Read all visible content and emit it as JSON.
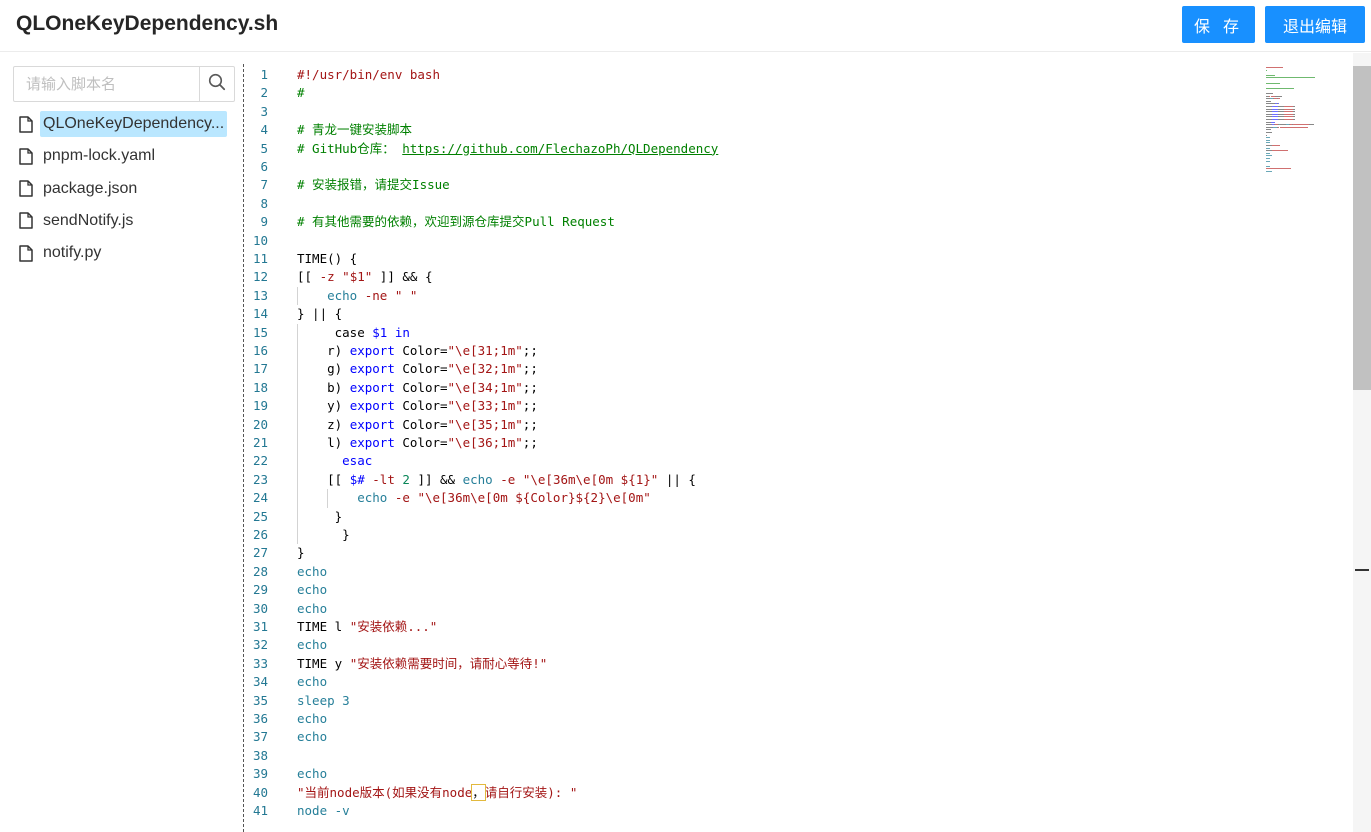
{
  "header": {
    "title": "QLOneKeyDependency.sh",
    "save_label": "保 存",
    "exit_label": "退出编辑",
    "accent_color": "#1890ff"
  },
  "sidebar": {
    "search": {
      "placeholder": "请输入脚本名",
      "value": "",
      "icon": "search-icon"
    },
    "files": [
      {
        "name": "QLOneKeyDependency...",
        "icon": "file-icon",
        "selected": true
      },
      {
        "name": "pnpm-lock.yaml",
        "icon": "file-icon",
        "selected": false
      },
      {
        "name": "package.json",
        "icon": "file-icon",
        "selected": false
      },
      {
        "name": "sendNotify.js",
        "icon": "file-icon",
        "selected": false
      },
      {
        "name": "notify.py",
        "icon": "file-icon",
        "selected": false
      }
    ]
  },
  "editor": {
    "language": "shell",
    "lines": [
      {
        "n": "1",
        "indent": 0,
        "tokens": [
          [
            "#!/usr/bin/env bash",
            "shebang"
          ]
        ]
      },
      {
        "n": "2",
        "indent": 0,
        "tokens": [
          [
            "#",
            "comment"
          ]
        ]
      },
      {
        "n": "3",
        "indent": 0,
        "tokens": []
      },
      {
        "n": "4",
        "indent": 0,
        "tokens": [
          [
            "# 青龙一键安装脚本",
            "comment"
          ]
        ]
      },
      {
        "n": "5",
        "indent": 0,
        "tokens": [
          [
            "# GitHub仓库： ",
            "comment"
          ],
          [
            "https://github.com/FlechazoPh/QLDependency",
            "link"
          ]
        ]
      },
      {
        "n": "6",
        "indent": 0,
        "tokens": []
      },
      {
        "n": "7",
        "indent": 0,
        "tokens": [
          [
            "# 安装报错，请提交Issue",
            "comment"
          ]
        ]
      },
      {
        "n": "8",
        "indent": 0,
        "tokens": []
      },
      {
        "n": "9",
        "indent": 0,
        "tokens": [
          [
            "# 有其他需要的依赖，欢迎到源仓库提交Pull Request",
            "comment"
          ]
        ]
      },
      {
        "n": "10",
        "indent": 0,
        "tokens": []
      },
      {
        "n": "11",
        "indent": 0,
        "tokens": [
          [
            "TIME() {",
            "plain"
          ]
        ]
      },
      {
        "n": "12",
        "indent": 0,
        "tokens": [
          [
            "[[ ",
            "plain"
          ],
          [
            "-z",
            "str"
          ],
          [
            " ",
            "plain"
          ],
          [
            "\"$1\"",
            "str"
          ],
          [
            " ]] && {",
            "plain"
          ]
        ]
      },
      {
        "n": "13",
        "indent": 1,
        "tokens": [
          [
            "    ",
            "plain"
          ],
          [
            "echo",
            "cmd"
          ],
          [
            " ",
            "plain"
          ],
          [
            "-ne",
            "str"
          ],
          [
            " ",
            "plain"
          ],
          [
            "\" \"",
            "str"
          ]
        ]
      },
      {
        "n": "14",
        "indent": 0,
        "tokens": [
          [
            "} || {",
            "plain"
          ]
        ]
      },
      {
        "n": "15",
        "indent": 1,
        "tokens": [
          [
            "     case ",
            "plain"
          ],
          [
            "$1",
            "kw"
          ],
          [
            " ",
            "plain"
          ],
          [
            "in",
            "kw"
          ]
        ]
      },
      {
        "n": "16",
        "indent": 1,
        "tokens": [
          [
            "    r) ",
            "plain"
          ],
          [
            "export",
            "kw"
          ],
          [
            " Color=",
            "plain"
          ],
          [
            "\"\\e[31;1m\"",
            "str"
          ],
          [
            ";;",
            "plain"
          ]
        ]
      },
      {
        "n": "17",
        "indent": 1,
        "tokens": [
          [
            "    g) ",
            "plain"
          ],
          [
            "export",
            "kw"
          ],
          [
            " Color=",
            "plain"
          ],
          [
            "\"\\e[32;1m\"",
            "str"
          ],
          [
            ";;",
            "plain"
          ]
        ]
      },
      {
        "n": "18",
        "indent": 1,
        "tokens": [
          [
            "    b) ",
            "plain"
          ],
          [
            "export",
            "kw"
          ],
          [
            " Color=",
            "plain"
          ],
          [
            "\"\\e[34;1m\"",
            "str"
          ],
          [
            ";;",
            "plain"
          ]
        ]
      },
      {
        "n": "19",
        "indent": 1,
        "tokens": [
          [
            "    y) ",
            "plain"
          ],
          [
            "export",
            "kw"
          ],
          [
            " Color=",
            "plain"
          ],
          [
            "\"\\e[33;1m\"",
            "str"
          ],
          [
            ";;",
            "plain"
          ]
        ]
      },
      {
        "n": "20",
        "indent": 1,
        "tokens": [
          [
            "    z) ",
            "plain"
          ],
          [
            "export",
            "kw"
          ],
          [
            " Color=",
            "plain"
          ],
          [
            "\"\\e[35;1m\"",
            "str"
          ],
          [
            ";;",
            "plain"
          ]
        ]
      },
      {
        "n": "21",
        "indent": 1,
        "tokens": [
          [
            "    l) ",
            "plain"
          ],
          [
            "export",
            "kw"
          ],
          [
            " Color=",
            "plain"
          ],
          [
            "\"\\e[36;1m\"",
            "str"
          ],
          [
            ";;",
            "plain"
          ]
        ]
      },
      {
        "n": "22",
        "indent": 1,
        "tokens": [
          [
            "      ",
            "plain"
          ],
          [
            "esac",
            "kw"
          ]
        ]
      },
      {
        "n": "23",
        "indent": 1,
        "tokens": [
          [
            "    [[ ",
            "plain"
          ],
          [
            "$#",
            "kw"
          ],
          [
            " ",
            "plain"
          ],
          [
            "-lt",
            "str"
          ],
          [
            " ",
            "plain"
          ],
          [
            "2",
            "num"
          ],
          [
            " ]] && ",
            "plain"
          ],
          [
            "echo",
            "cmd"
          ],
          [
            " ",
            "plain"
          ],
          [
            "-e",
            "str"
          ],
          [
            " ",
            "plain"
          ],
          [
            "\"\\e[36m\\e[0m ${1}\"",
            "str"
          ],
          [
            " || {",
            "plain"
          ]
        ]
      },
      {
        "n": "24",
        "indent": 2,
        "tokens": [
          [
            "        ",
            "plain"
          ],
          [
            "echo",
            "cmd"
          ],
          [
            " ",
            "plain"
          ],
          [
            "-e",
            "str"
          ],
          [
            " ",
            "plain"
          ],
          [
            "\"\\e[36m\\e[0m ${Color}${2}\\e[0m\"",
            "str"
          ]
        ]
      },
      {
        "n": "25",
        "indent": 1,
        "tokens": [
          [
            "     }",
            "plain"
          ]
        ]
      },
      {
        "n": "26",
        "indent": 1,
        "tokens": [
          [
            "      }",
            "plain"
          ]
        ]
      },
      {
        "n": "27",
        "indent": 0,
        "tokens": [
          [
            "}",
            "plain"
          ]
        ]
      },
      {
        "n": "28",
        "indent": 0,
        "tokens": [
          [
            "echo",
            "cmd"
          ]
        ]
      },
      {
        "n": "29",
        "indent": 0,
        "tokens": [
          [
            "echo",
            "cmd"
          ]
        ]
      },
      {
        "n": "30",
        "indent": 0,
        "tokens": [
          [
            "echo",
            "cmd"
          ]
        ]
      },
      {
        "n": "31",
        "indent": 0,
        "tokens": [
          [
            "TIME l ",
            "plain"
          ],
          [
            "\"安装依赖...\"",
            "str"
          ]
        ]
      },
      {
        "n": "32",
        "indent": 0,
        "tokens": [
          [
            "echo",
            "cmd"
          ]
        ]
      },
      {
        "n": "33",
        "indent": 0,
        "tokens": [
          [
            "TIME y ",
            "plain"
          ],
          [
            "\"安装依赖需要时间，请耐心等待!\"",
            "str"
          ]
        ]
      },
      {
        "n": "34",
        "indent": 0,
        "tokens": [
          [
            "echo",
            "cmd"
          ]
        ]
      },
      {
        "n": "35",
        "indent": 0,
        "tokens": [
          [
            "sleep 3",
            "cmd"
          ]
        ]
      },
      {
        "n": "36",
        "indent": 0,
        "tokens": [
          [
            "echo",
            "cmd"
          ]
        ]
      },
      {
        "n": "37",
        "indent": 0,
        "tokens": [
          [
            "echo",
            "cmd"
          ]
        ]
      },
      {
        "n": "38",
        "indent": 0,
        "tokens": []
      },
      {
        "n": "39",
        "indent": 0,
        "tokens": [
          [
            "echo",
            "cmd"
          ]
        ]
      },
      {
        "n": "40",
        "indent": 0,
        "tokens": [
          [
            "\"当前node版本(如果没有node",
            "str"
          ],
          [
            "，",
            "hl"
          ],
          [
            "请自行安装): \"",
            "str"
          ]
        ]
      },
      {
        "n": "41",
        "indent": 0,
        "tokens": [
          [
            "node -v",
            "cmd"
          ]
        ]
      }
    ]
  },
  "colors": {
    "comment": "#008000",
    "string": "#a31515",
    "keyword": "#0000ff",
    "command": "#267f99",
    "number": "#098658",
    "line_number": "#237893",
    "selected_file_bg": "#bae7ff"
  }
}
